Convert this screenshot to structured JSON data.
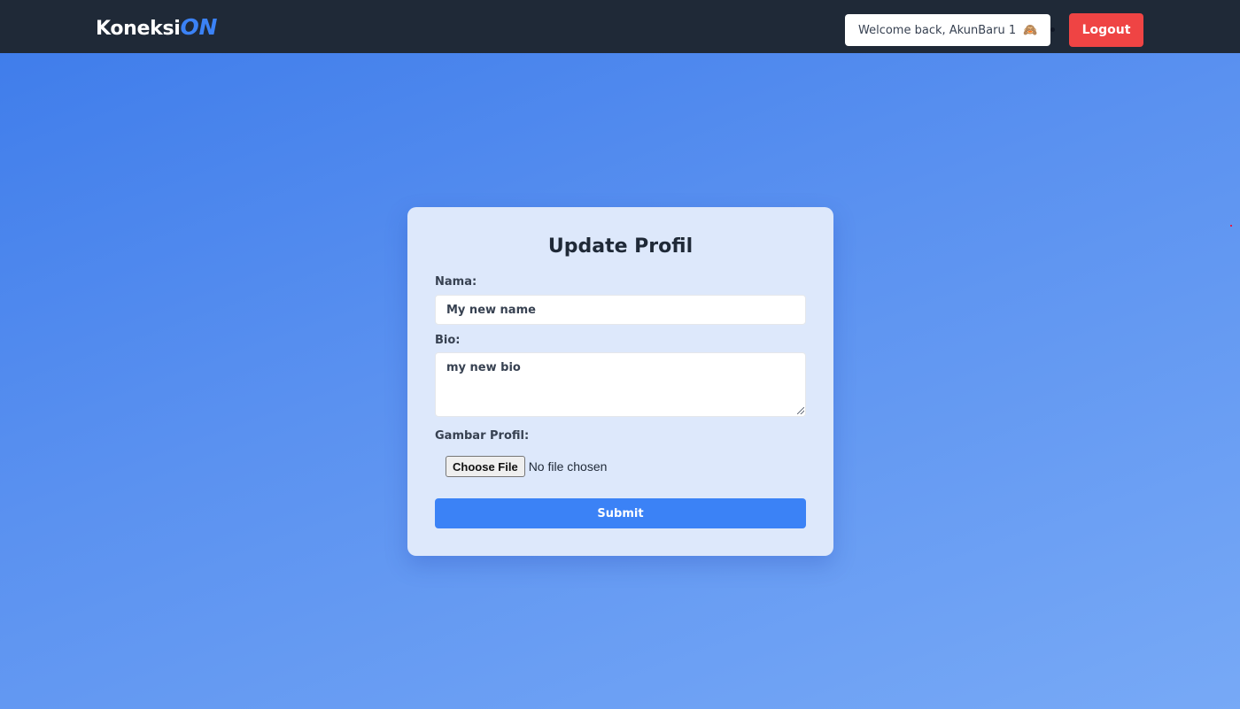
{
  "navbar": {
    "brand_main": "Koneksi",
    "brand_accent": "ON",
    "welcome_text": "Welcome back, AkunBaru 1",
    "welcome_emoji": "🙈",
    "logout_label": "Logout"
  },
  "form": {
    "title": "Update Profil",
    "name_label": "Nama:",
    "name_value": "My new name",
    "bio_label": "Bio:",
    "bio_value": "my new bio",
    "picture_label": "Gambar Profil:",
    "choose_file_label": "Choose File",
    "file_status": "No file chosen",
    "submit_label": "Submit"
  },
  "colors": {
    "navbar_bg": "#1f2937",
    "brand_accent": "#3b82f6",
    "logout_bg": "#ef4444",
    "submit_bg": "#3b82f6",
    "card_bg": "#dde8fb"
  }
}
